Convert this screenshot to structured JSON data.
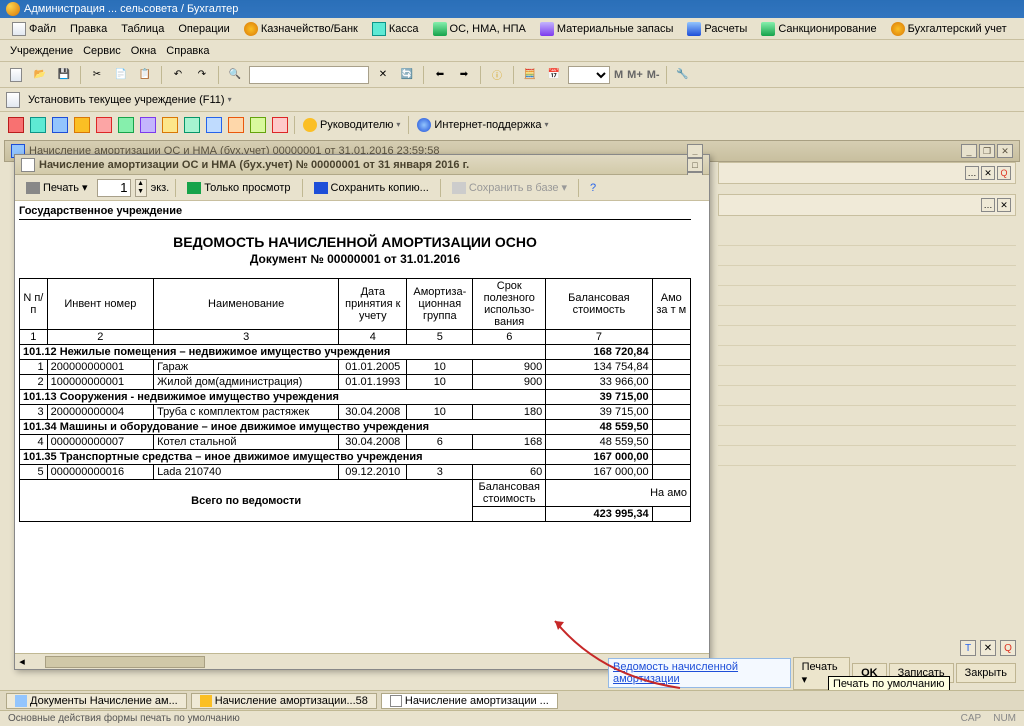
{
  "titlebar": "Администрация ... сельсовета / Бухгалтер",
  "menu1": {
    "items": [
      {
        "label": "Файл",
        "icon": "ic-doc"
      },
      {
        "label": "Правка",
        "icon": ""
      },
      {
        "label": "Таблица",
        "icon": ""
      },
      {
        "label": "Операции",
        "icon": ""
      },
      {
        "label": "Казначейство/Банк",
        "icon": "ic-coin"
      },
      {
        "label": "Касса",
        "icon": "ic-cyan"
      },
      {
        "label": "ОС, НМА, НПА",
        "icon": "ic-green"
      },
      {
        "label": "Материальные запасы",
        "icon": "ic-purple"
      },
      {
        "label": "Расчеты",
        "icon": "ic-blue"
      },
      {
        "label": "Санкционирование",
        "icon": "ic-green"
      },
      {
        "label": "Бухгалтерский учет",
        "icon": "ic-coin"
      }
    ]
  },
  "menu2": {
    "items": [
      "Учреждение",
      "Сервис",
      "Окна",
      "Справка"
    ]
  },
  "toolbar": {
    "mlabels": [
      "M",
      "M+",
      "M-"
    ]
  },
  "instrow": {
    "label": "Установить текущее учреждение (F11)"
  },
  "toolbar3": {
    "manager": "Руководителю",
    "internet": "Интернет-поддержка"
  },
  "mdiparent_title": "Начисление амортизации ОС и НМА (бух.учет) 00000001 от 31.01.2016 23:59:58",
  "childwin_title": "Начисление амортизации ОС и НМА (бух.учет) № 00000001 от 31 января 2016 г.",
  "cw_toolbar": {
    "print": "Печать",
    "copies": "1",
    "ekz": "экз.",
    "viewonly": "Только просмотр",
    "savecopy": "Сохранить копию...",
    "savedb": "Сохранить в базе"
  },
  "doc": {
    "institution": "Государственное учреждение",
    "title": "ВЕДОМОСТЬ НАЧИСЛЕННОЙ АМОРТИЗАЦИИ ОСНО",
    "subtitle": "Документ № 00000001 от 31.01.2016",
    "headers": {
      "n": "N п/п",
      "inv": "Инвент номер",
      "name": "Наименование",
      "date": "Дата принятия к учету",
      "group": "Амортиза-\nционная группа",
      "life": "Срок полезного использо-\nвания",
      "bal": "Балансовая стоимость",
      "amo": "Амо за т м"
    },
    "colnums": [
      "1",
      "2",
      "3",
      "4",
      "5",
      "6",
      "7"
    ],
    "rows": [
      {
        "grp": "101.12 Нежилые помещения – недвижимое имущество учреждения",
        "sum": "168 720,84"
      },
      {
        "n": "1",
        "inv": "200000000001",
        "name": "Гараж",
        "date": "01.01.2005",
        "group": "10",
        "life": "900",
        "bal": "134 754,84"
      },
      {
        "n": "2",
        "inv": "100000000001",
        "name": "Жилой дом(администрация)",
        "date": "01.01.1993",
        "group": "10",
        "life": "900",
        "bal": "33 966,00"
      },
      {
        "grp": "101.13 Сооружения - недвижимое имущество учреждения",
        "sum": "39 715,00"
      },
      {
        "n": "3",
        "inv": "200000000004",
        "name": "Труба с комплектом растяжек",
        "date": "30.04.2008",
        "group": "10",
        "life": "180",
        "bal": "39 715,00"
      },
      {
        "grp": "101.34 Машины и оборудование – иное движимое имущество учреждения",
        "sum": "48 559,50"
      },
      {
        "n": "4",
        "inv": "000000000007",
        "name": "Котел стальной",
        "date": "30.04.2008",
        "group": "6",
        "life": "168",
        "bal": "48 559,50"
      },
      {
        "grp": "101.35 Транспортные средства – иное движимое имущество учреждения",
        "sum": "167 000,00"
      },
      {
        "n": "5",
        "inv": "000000000016",
        "name": "Lada 210740",
        "date": "09.12.2010",
        "group": "3",
        "life": "60",
        "bal": "167 000,00"
      }
    ],
    "total_label": "Всего по ведомости",
    "total_bal_header": "Балансовая стоимость",
    "total_right_header": "На амо",
    "total_value": "423 995,34"
  },
  "actionbar": {
    "link": "Ведомость начисленной амортизации",
    "print": "Печать",
    "ok": "OK",
    "write": "Записать",
    "close": "Закрыть"
  },
  "taskbar": {
    "tab1": "Документы Начисление ам...",
    "tab2": "Начисление амортизации...58",
    "tab3": "Начисление амортизации ..."
  },
  "statusbar": {
    "hint": "Основные действия формы печать по умолчанию",
    "cap": "CAP",
    "num": "NUM"
  },
  "link_tooltip": "Печать по умолчанию"
}
